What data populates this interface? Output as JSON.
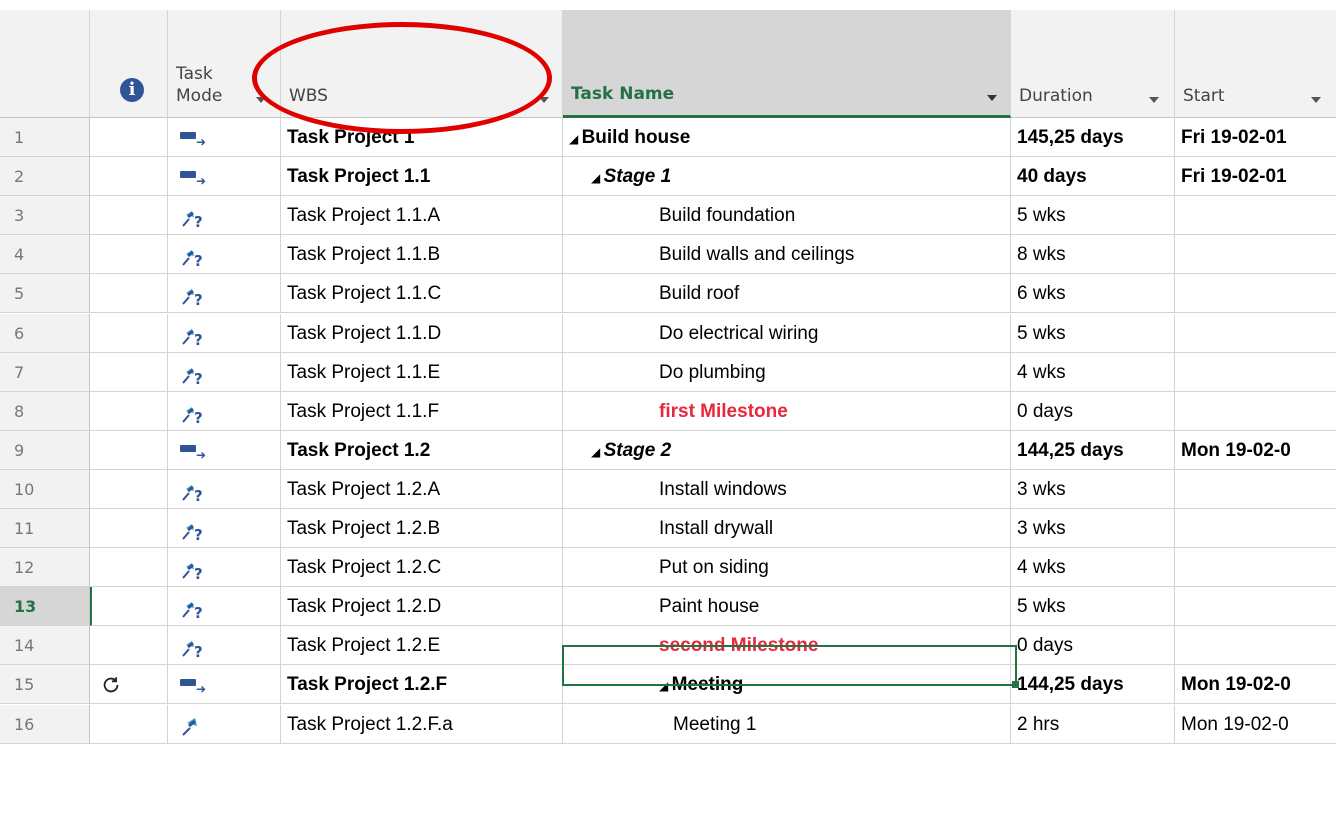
{
  "headers": {
    "task_mode": "Task\nMode",
    "wbs": "WBS",
    "task_name": "Task Name",
    "duration": "Duration",
    "start": "Start"
  },
  "icons": {
    "info": "info-icon",
    "auto": "auto-scheduled-icon",
    "manual": "manual-scheduled-icon",
    "pinned": "manual-pinned-icon",
    "recurring": "recurring-icon"
  },
  "colors": {
    "accent": "#217346",
    "milestone": "#e8283c",
    "annotation": "#e00000"
  },
  "rows": [
    {
      "id": "1",
      "mode": "auto",
      "wbs": "Task Project 1",
      "name": "Build house",
      "duration": "145,25 days",
      "start": "Fri 19-02-01",
      "indent": 0,
      "summary": true,
      "italic": false,
      "milestone": false
    },
    {
      "id": "2",
      "mode": "auto",
      "wbs": "Task Project 1.1",
      "name": "Stage 1",
      "duration": "40 days",
      "start": "Fri 19-02-01",
      "indent": 1,
      "summary": true,
      "italic": true,
      "milestone": false
    },
    {
      "id": "3",
      "mode": "manual",
      "wbs": "Task Project 1.1.A",
      "name": "Build foundation",
      "duration": "5 wks",
      "start": "",
      "indent": 2,
      "summary": false,
      "italic": false,
      "milestone": false
    },
    {
      "id": "4",
      "mode": "manual",
      "wbs": "Task Project 1.1.B",
      "name": "Build walls and ceilings",
      "duration": "8 wks",
      "start": "",
      "indent": 2,
      "summary": false,
      "italic": false,
      "milestone": false
    },
    {
      "id": "5",
      "mode": "manual",
      "wbs": "Task Project 1.1.C",
      "name": "Build roof",
      "duration": "6 wks",
      "start": "",
      "indent": 2,
      "summary": false,
      "italic": false,
      "milestone": false
    },
    {
      "id": "6",
      "mode": "manual",
      "wbs": "Task Project 1.1.D",
      "name": "Do electrical wiring",
      "duration": "5 wks",
      "start": "",
      "indent": 2,
      "summary": false,
      "italic": false,
      "milestone": false
    },
    {
      "id": "7",
      "mode": "manual",
      "wbs": "Task Project 1.1.E",
      "name": "Do plumbing",
      "duration": "4 wks",
      "start": "",
      "indent": 2,
      "summary": false,
      "italic": false,
      "milestone": false
    },
    {
      "id": "8",
      "mode": "manual",
      "wbs": "Task Project 1.1.F",
      "name": "first Milestone",
      "duration": "0 days",
      "start": "",
      "indent": 2,
      "summary": false,
      "italic": false,
      "milestone": true
    },
    {
      "id": "9",
      "mode": "auto",
      "wbs": "Task Project 1.2",
      "name": "Stage 2",
      "duration": "144,25 days",
      "start": "Mon 19-02-0",
      "indent": 1,
      "summary": true,
      "italic": true,
      "milestone": false
    },
    {
      "id": "10",
      "mode": "manual",
      "wbs": "Task Project 1.2.A",
      "name": "Install windows",
      "duration": "3 wks",
      "start": "",
      "indent": 2,
      "summary": false,
      "italic": false,
      "milestone": false
    },
    {
      "id": "11",
      "mode": "manual",
      "wbs": "Task Project 1.2.B",
      "name": "Install drywall",
      "duration": "3 wks",
      "start": "",
      "indent": 2,
      "summary": false,
      "italic": false,
      "milestone": false
    },
    {
      "id": "12",
      "mode": "manual",
      "wbs": "Task Project 1.2.C",
      "name": "Put on siding",
      "duration": "4 wks",
      "start": "",
      "indent": 2,
      "summary": false,
      "italic": false,
      "milestone": false
    },
    {
      "id": "13",
      "mode": "manual",
      "wbs": "Task Project 1.2.D",
      "name": "Paint house",
      "duration": "5 wks",
      "start": "",
      "indent": 2,
      "summary": false,
      "italic": false,
      "milestone": false,
      "selected": true
    },
    {
      "id": "14",
      "mode": "manual",
      "wbs": "Task Project 1.2.E",
      "name": "second Milestone",
      "duration": "0 days",
      "start": "",
      "indent": 2,
      "summary": false,
      "italic": false,
      "milestone": true
    },
    {
      "id": "15",
      "mode": "auto",
      "wbs": "Task Project 1.2.F",
      "name": "Meeting",
      "duration": "144,25 days",
      "start": "Mon 19-02-0",
      "indent": 2,
      "summary": true,
      "italic": false,
      "milestone": false,
      "recurring": true
    },
    {
      "id": "16",
      "mode": "pinned",
      "wbs": "Task Project 1.2.F.a",
      "name": "Meeting 1",
      "duration": "2 hrs",
      "start": "Mon 19-02-0",
      "indent": 3,
      "summary": false,
      "italic": false,
      "milestone": false
    }
  ]
}
